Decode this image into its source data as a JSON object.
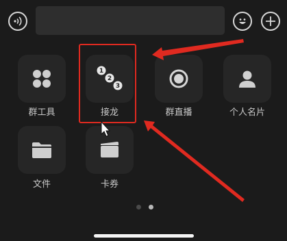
{
  "topbar": {
    "voice_icon": "voice-icon",
    "emoji_icon": "emoji-icon",
    "plus_icon": "plus-icon"
  },
  "grid": {
    "items": [
      {
        "label": "群工具",
        "icon": "group-tools-icon"
      },
      {
        "label": "接龙",
        "icon": "solitaire-icon"
      },
      {
        "label": "群直播",
        "icon": "group-live-icon"
      },
      {
        "label": "个人名片",
        "icon": "contact-card-icon"
      },
      {
        "label": "文件",
        "icon": "folder-icon"
      },
      {
        "label": "卡券",
        "icon": "card-coupon-icon"
      }
    ],
    "solitaire_numbers": [
      "1",
      "2",
      "3"
    ]
  },
  "pagination": {
    "pages": 2,
    "current": 2
  },
  "colors": {
    "background": "#1b1b1b",
    "tile": "#262626",
    "annotation_red": "#e02a20"
  }
}
